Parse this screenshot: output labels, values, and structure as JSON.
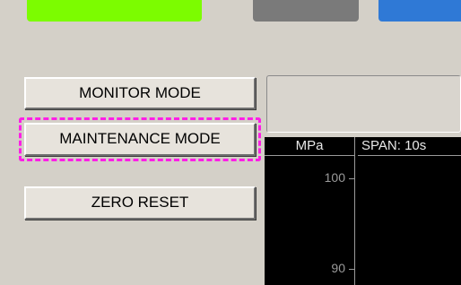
{
  "indicators": [
    {
      "name": "status-green",
      "color": "#7cfc00"
    },
    {
      "name": "status-gray",
      "color": "#7a7a7a"
    },
    {
      "name": "status-blue",
      "color": "#2f79d6"
    }
  ],
  "buttons": {
    "monitor_mode": "MONITOR MODE",
    "maintenance_mode": "MAINTENANCE MODE",
    "zero_reset": "ZERO RESET"
  },
  "chart": {
    "unit_label": "MPa",
    "span_label": "SPAN: 10s",
    "y_ticks": [
      "100",
      "90"
    ]
  },
  "colors": {
    "focus_ring": "#ff1ee6",
    "chart_background": "#000000"
  }
}
